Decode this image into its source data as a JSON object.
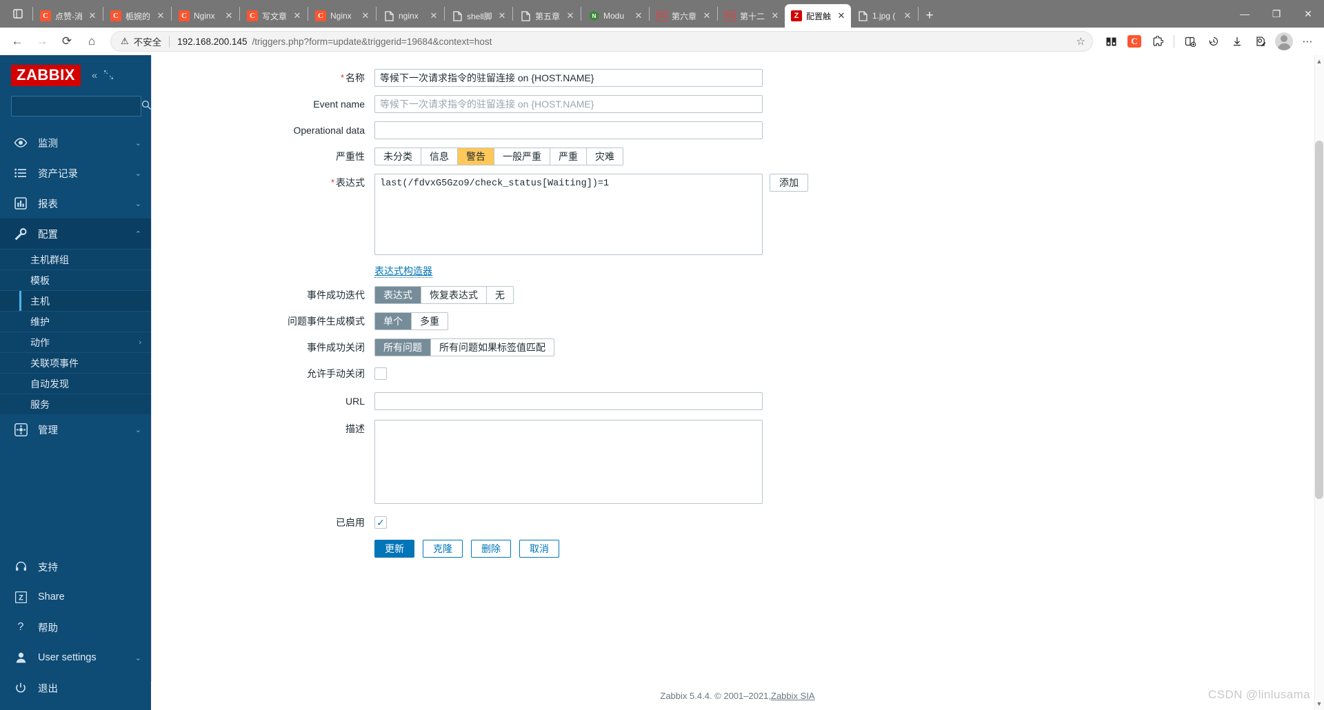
{
  "browser": {
    "tabs": [
      {
        "title": "点赞-消",
        "favicon": "csdn-icon",
        "active": false
      },
      {
        "title": "栀婉的",
        "favicon": "csdn-icon",
        "active": false
      },
      {
        "title": "Nginx",
        "favicon": "csdn-icon",
        "active": false
      },
      {
        "title": "写文章",
        "favicon": "csdn-icon",
        "active": false
      },
      {
        "title": "Nginx",
        "favicon": "csdn-icon",
        "active": false
      },
      {
        "title": "nginx",
        "favicon": "document-icon",
        "active": false
      },
      {
        "title": "shell脚",
        "favicon": "document-icon",
        "active": false
      },
      {
        "title": "第五章",
        "favicon": "document-icon",
        "active": false
      },
      {
        "title": "Modu",
        "favicon": "nodejs-icon",
        "active": false
      },
      {
        "title": "第六章",
        "favicon": "51cto-icon",
        "active": false
      },
      {
        "title": "第十二",
        "favicon": "51cto-icon",
        "active": false
      },
      {
        "title": "配置触",
        "favicon": "zabbix-icon",
        "active": true
      },
      {
        "title": "1.jpg (",
        "favicon": "document-icon",
        "active": false
      }
    ],
    "new_tab_label": "+",
    "window_controls": {
      "minimize": "—",
      "maximize": "❐",
      "close": "✕"
    },
    "nav": {
      "back": "←",
      "forward": "→",
      "reload": "⟳",
      "home": "⌂"
    },
    "omnibox": {
      "security_icon": "warning-triangle-icon",
      "security_label": "不安全",
      "url_host": "192.168.200.145",
      "url_path": "/triggers.php?form=update&triggerid=19684&context=host",
      "favorite_icon": "star-plus-icon"
    },
    "toolbar_icons": [
      "collections-icon",
      "csdn-extension-icon",
      "extensions-icon",
      "split-screen-icon",
      "history-icon",
      "downloads-icon",
      "collections-pen-icon",
      "profile-avatar",
      "more-icon"
    ]
  },
  "sidebar": {
    "logo": "ZABBIX",
    "collapse_icon": "«",
    "expand_icon": "⛶",
    "search_placeholder": "",
    "search_value": "",
    "items": [
      {
        "label": "监测",
        "icon": "eye-icon",
        "arrow": "chevron-down-icon",
        "active": false
      },
      {
        "label": "资产记录",
        "icon": "list-icon",
        "arrow": "chevron-down-icon",
        "active": false
      },
      {
        "label": "报表",
        "icon": "chart-icon",
        "arrow": "chevron-down-icon",
        "active": false
      },
      {
        "label": "配置",
        "icon": "wrench-icon",
        "arrow": "chevron-up-icon",
        "active": true
      }
    ],
    "sub_items": [
      {
        "label": "主机群组",
        "selected": false,
        "arrow": ""
      },
      {
        "label": "模板",
        "selected": false,
        "arrow": ""
      },
      {
        "label": "主机",
        "selected": true,
        "arrow": ""
      },
      {
        "label": "维护",
        "selected": false,
        "arrow": ""
      },
      {
        "label": "动作",
        "selected": false,
        "arrow": "›"
      },
      {
        "label": "关联项事件",
        "selected": false,
        "arrow": ""
      },
      {
        "label": "自动发现",
        "selected": false,
        "arrow": ""
      },
      {
        "label": "服务",
        "selected": false,
        "arrow": ""
      }
    ],
    "admin": {
      "label": "管理",
      "icon": "gear-icon",
      "arrow": "chevron-down-icon"
    },
    "bottom_items": [
      {
        "label": "支持",
        "icon": "headset-icon",
        "arrow": ""
      },
      {
        "label": "Share",
        "icon": "zabbix-share-icon",
        "arrow": ""
      },
      {
        "label": "帮助",
        "icon": "question-icon",
        "arrow": ""
      },
      {
        "label": "User settings",
        "icon": "user-icon",
        "arrow": "chevron-down-icon"
      },
      {
        "label": "退出",
        "icon": "power-icon",
        "arrow": ""
      }
    ]
  },
  "form": {
    "name": {
      "label": "名称",
      "required": true,
      "value": "等候下一次请求指令的驻留连接 on {HOST.NAME}",
      "placeholder": ""
    },
    "event_name": {
      "label": "Event name",
      "required": false,
      "value": "",
      "placeholder": "等候下一次请求指令的驻留连接 on {HOST.NAME}"
    },
    "operational_data": {
      "label": "Operational data",
      "required": false,
      "value": "",
      "placeholder": ""
    },
    "severity": {
      "label": "严重性",
      "options": [
        "未分类",
        "信息",
        "警告",
        "一般严重",
        "严重",
        "灾难"
      ],
      "selected": "警告",
      "selected_color": "#ffc859"
    },
    "expression": {
      "label": "表达式",
      "required": true,
      "value": "last(/fdvxG5Gzo9/check_status[Waiting])=1",
      "add_button": "添加",
      "builder_link": "表达式构造器"
    },
    "ok_event_generation": {
      "label": "事件成功迭代",
      "options": [
        "表达式",
        "恢复表达式",
        "无"
      ],
      "selected": "表达式"
    },
    "problem_event_generation_mode": {
      "label": "问题事件生成模式",
      "options": [
        "单个",
        "多重"
      ],
      "selected": "单个"
    },
    "ok_event_closes": {
      "label": "事件成功关闭",
      "options": [
        "所有问题",
        "所有问题如果标签值匹配"
      ],
      "selected": "所有问题"
    },
    "allow_manual_close": {
      "label": "允许手动关闭",
      "checked": false
    },
    "url": {
      "label": "URL",
      "value": "",
      "placeholder": ""
    },
    "description": {
      "label": "描述",
      "value": "",
      "placeholder": ""
    },
    "enabled": {
      "label": "已启用",
      "checked": true,
      "check_glyph": "✓"
    },
    "buttons": [
      {
        "label": "更新",
        "primary": true
      },
      {
        "label": "克隆",
        "primary": false
      },
      {
        "label": "删除",
        "primary": false
      },
      {
        "label": "取消",
        "primary": false
      }
    ]
  },
  "footer": {
    "text_before": "Zabbix 5.4.4. © 2001–2021, ",
    "link": "Zabbix SIA",
    "watermark": "CSDN @linlusama"
  },
  "colors": {
    "zabbix_blue": "#0e4b75",
    "accent": "#0275b8",
    "warning": "#ffc859",
    "segment_on": "#768d99",
    "brand_red": "#d40000"
  }
}
